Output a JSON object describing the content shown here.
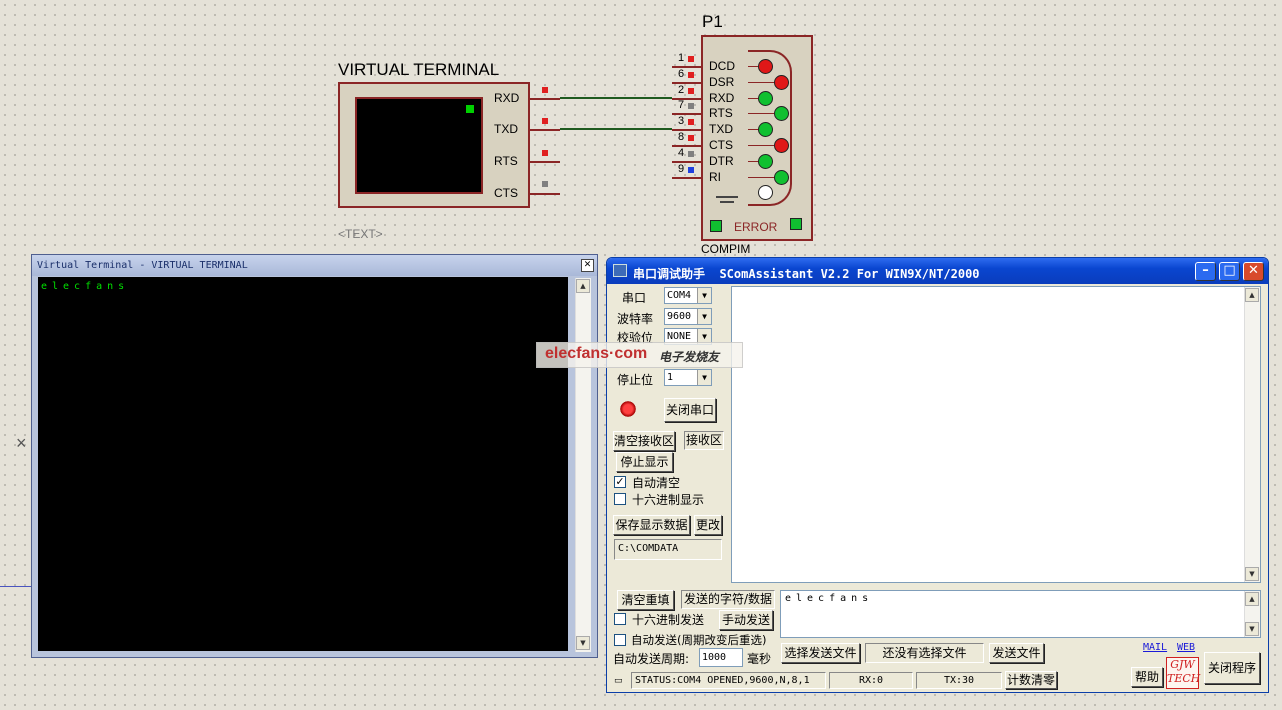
{
  "schematic": {
    "vt_title": "VIRTUAL TERMINAL",
    "vt_pins": [
      "RXD",
      "TXD",
      "RTS",
      "CTS"
    ],
    "vt_text_placeholder": "<TEXT>",
    "p1_label": "P1",
    "p1_type": "COMPIM",
    "p1_pins": [
      {
        "num": "1",
        "name": "DCD",
        "led": "red"
      },
      {
        "num": "6",
        "name": "DSR",
        "led": "red"
      },
      {
        "num": "2",
        "name": "RXD",
        "led": "green"
      },
      {
        "num": "7",
        "name": "RTS",
        "led": "green"
      },
      {
        "num": "3",
        "name": "TXD",
        "led": "green"
      },
      {
        "num": "8",
        "name": "CTS",
        "led": "red"
      },
      {
        "num": "4",
        "name": "DTR",
        "led": "green"
      },
      {
        "num": "9",
        "name": "RI",
        "led": "green"
      }
    ],
    "p1_error": "ERROR"
  },
  "vt_window": {
    "title": "Virtual Terminal - VIRTUAL TERMINAL",
    "output": "elecfans",
    "close_glyph": "✕"
  },
  "sca": {
    "title": "串口调试助手  SComAssistant V2.2 For WIN9X/NT/2000",
    "settings": [
      {
        "label": "串口",
        "value": "COM4"
      },
      {
        "label": "波特率",
        "value": "9600"
      },
      {
        "label": "校验位",
        "value": "NONE"
      },
      {
        "label": "停止位",
        "value": "1"
      }
    ],
    "close_port": "关闭串口",
    "clear_recv": "清空接收区",
    "recv_area": "接收区",
    "stop_display": "停止显示",
    "auto_clear": "自动清空",
    "hex_display": "十六进制显示",
    "save_display": "保存显示数据",
    "change": "更改",
    "save_path": "C:\\COMDATA",
    "clear_reset": "清空重填",
    "send_label": "发送的字符/数据",
    "hex_send": "十六进制发送",
    "manual_send": "手动发送",
    "auto_send": "自动发送(周期改变后重选)",
    "period_label": "自动发送周期:",
    "period_value": "1000",
    "ms": "毫秒",
    "select_file": "选择发送文件",
    "no_file": "还没有选择文件",
    "send_file": "发送文件",
    "send_text": "elecfans",
    "mail": "MAIL",
    "web": "WEB",
    "help": "帮助",
    "logo_top": "GJW",
    "logo_bottom": "TECH",
    "close_program": "关闭程序",
    "status": "STATUS:COM4 OPENED,9600,N,8,1",
    "rx": "RX:0",
    "tx": "TX:30",
    "count_reset": "计数清零"
  },
  "watermark": {
    "brand": "elecfans·com",
    "cn": "电子发烧友"
  }
}
